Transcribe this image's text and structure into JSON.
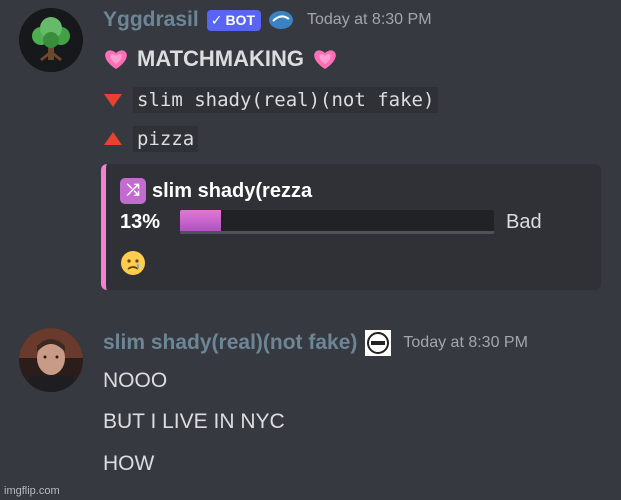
{
  "message1": {
    "username": "Yggdrasil",
    "username_color": "#6d8696",
    "bot_tag": "BOT",
    "timestamp": "Today at 8:30 PM",
    "title": "MATCHMAKING",
    "arrow_down_text": "slim shady(real)(not fake)",
    "arrow_up_text": "pizza",
    "embed": {
      "title": "slim shady(rezza",
      "percent_label": "13%",
      "percent_value": 13,
      "rating": "Bad",
      "accent_color": "#f47fd3"
    },
    "icons": [
      "tree-avatar",
      "check-icon",
      "server-badge-icon",
      "sparkling-heart-icon",
      "red-triangle-down-icon",
      "red-triangle-up-icon",
      "shuffle-icon",
      "crying-face-icon"
    ]
  },
  "message2": {
    "username": "slim shady(real)(not fake)",
    "username_color": "#6d8696",
    "timestamp": "Today at 8:30 PM",
    "lines": [
      "NOOO",
      "BUT I LIVE IN NYC",
      "HOW"
    ]
  },
  "watermark": "imgflip.com"
}
